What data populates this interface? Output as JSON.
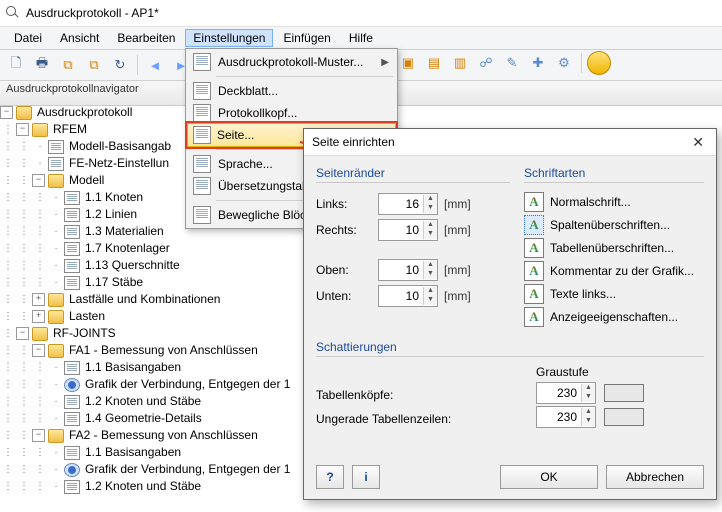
{
  "window": {
    "title": "Ausdruckprotokoll - AP1*"
  },
  "menubar": [
    "Datei",
    "Ansicht",
    "Bearbeiten",
    "Einstellungen",
    "Einfügen",
    "Hilfe"
  ],
  "menubar_active_index": 3,
  "nav_header": "Ausdruckprotokollnavigator",
  "tree": [
    {
      "d": 0,
      "exp": "-",
      "ic": "folder",
      "t": "Ausdruckprotokoll"
    },
    {
      "d": 1,
      "exp": "-",
      "ic": "folder",
      "t": "RFEM"
    },
    {
      "d": 2,
      "exp": "",
      "ic": "page",
      "t": "Modell-Basisangab"
    },
    {
      "d": 2,
      "exp": "",
      "ic": "page",
      "t": "FE-Netz-Einstellun"
    },
    {
      "d": 2,
      "exp": "-",
      "ic": "folder",
      "t": "Modell"
    },
    {
      "d": 3,
      "exp": "",
      "ic": "page",
      "t": "1.1 Knoten"
    },
    {
      "d": 3,
      "exp": "",
      "ic": "page",
      "t": "1.2 Linien"
    },
    {
      "d": 3,
      "exp": "",
      "ic": "page",
      "t": "1.3 Materialien"
    },
    {
      "d": 3,
      "exp": "",
      "ic": "page",
      "t": "1.7 Knotenlager"
    },
    {
      "d": 3,
      "exp": "",
      "ic": "page",
      "t": "1.13 Querschnitte"
    },
    {
      "d": 3,
      "exp": "",
      "ic": "page",
      "t": "1.17 Stäbe"
    },
    {
      "d": 2,
      "exp": "+",
      "ic": "folder",
      "t": "Lastfälle und Kombinationen"
    },
    {
      "d": 2,
      "exp": "+",
      "ic": "folder",
      "t": "Lasten"
    },
    {
      "d": 1,
      "exp": "-",
      "ic": "folder",
      "t": "RF-JOINTS"
    },
    {
      "d": 2,
      "exp": "-",
      "ic": "folder",
      "t": "FA1 - Bemessung von Anschlüssen"
    },
    {
      "d": 3,
      "exp": "",
      "ic": "page",
      "t": "1.1 Basisangaben"
    },
    {
      "d": 3,
      "exp": "",
      "ic": "eye",
      "t": "Grafik der Verbindung, Entgegen der 1"
    },
    {
      "d": 3,
      "exp": "",
      "ic": "page",
      "t": "1.2 Knoten und Stäbe"
    },
    {
      "d": 3,
      "exp": "",
      "ic": "page",
      "t": "1.4 Geometrie-Details"
    },
    {
      "d": 2,
      "exp": "-",
      "ic": "folder",
      "t": "FA2 - Bemessung von Anschlüssen"
    },
    {
      "d": 3,
      "exp": "",
      "ic": "page",
      "t": "1.1 Basisangaben"
    },
    {
      "d": 3,
      "exp": "",
      "ic": "eye",
      "t": "Grafik der Verbindung, Entgegen der 1"
    },
    {
      "d": 3,
      "exp": "",
      "ic": "page",
      "t": "1.2 Knoten und Stäbe"
    }
  ],
  "dropdown": {
    "items": [
      {
        "label": "Ausdruckprotokoll-Muster...",
        "submenu": true
      },
      {
        "sep": true
      },
      {
        "label": "Deckblatt..."
      },
      {
        "label": "Protokollkopf..."
      },
      {
        "label": "Seite...",
        "hl": true,
        "hover": true
      },
      {
        "sep": true
      },
      {
        "label": "Sprache..."
      },
      {
        "label": "Übersetzungstabe"
      },
      {
        "sep": true
      },
      {
        "label": "Bewegliche Blöck"
      }
    ]
  },
  "dialog": {
    "title": "Seite einrichten",
    "groups": {
      "margins": "Seitenränder",
      "fonts": "Schriftarten",
      "shading": "Schattierungen",
      "graylevel": "Graustufe"
    },
    "margins": {
      "left_label": "Links:",
      "left_value": "16",
      "right_label": "Rechts:",
      "right_value": "10",
      "top_label": "Oben:",
      "top_value": "10",
      "bottom_label": "Unten:",
      "bottom_value": "10",
      "unit": "[mm]"
    },
    "fonts": [
      "Normalschrift...",
      "Spaltenüberschriften...",
      "Tabellenüberschriften...",
      "Kommentar zu der Grafik...",
      "Texte links...",
      "Anzeigeeigenschaften..."
    ],
    "fonts_selected_index": 1,
    "shading": {
      "heads_label": "Tabellenköpfe:",
      "heads_value": "230",
      "odd_label": "Ungerade Tabellenzeilen:",
      "odd_value": "230"
    },
    "buttons": {
      "ok": "OK",
      "cancel": "Abbrechen"
    }
  }
}
